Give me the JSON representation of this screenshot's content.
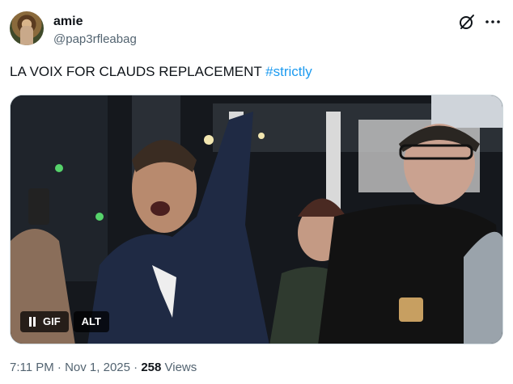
{
  "author": {
    "name": "amie",
    "handle": "@pap3rfleabag"
  },
  "icons": {
    "grok": "grok-icon",
    "more": "more-options-icon",
    "pause": "pause-icon"
  },
  "tweet": {
    "text": "LA VOIX FOR CLAUDS REPLACEMENT ",
    "hashtag": "#strictly"
  },
  "media": {
    "gif_label": "GIF",
    "alt_label": "ALT"
  },
  "meta": {
    "time": "7:11 PM",
    "sep1": " · ",
    "date": "Nov 1, 2025",
    "sep2": " · ",
    "views_count": "258",
    "views_label": " Views"
  },
  "colors": {
    "link": "#1d9bf0",
    "secondary_text": "#536471",
    "primary_text": "#0f1419"
  }
}
